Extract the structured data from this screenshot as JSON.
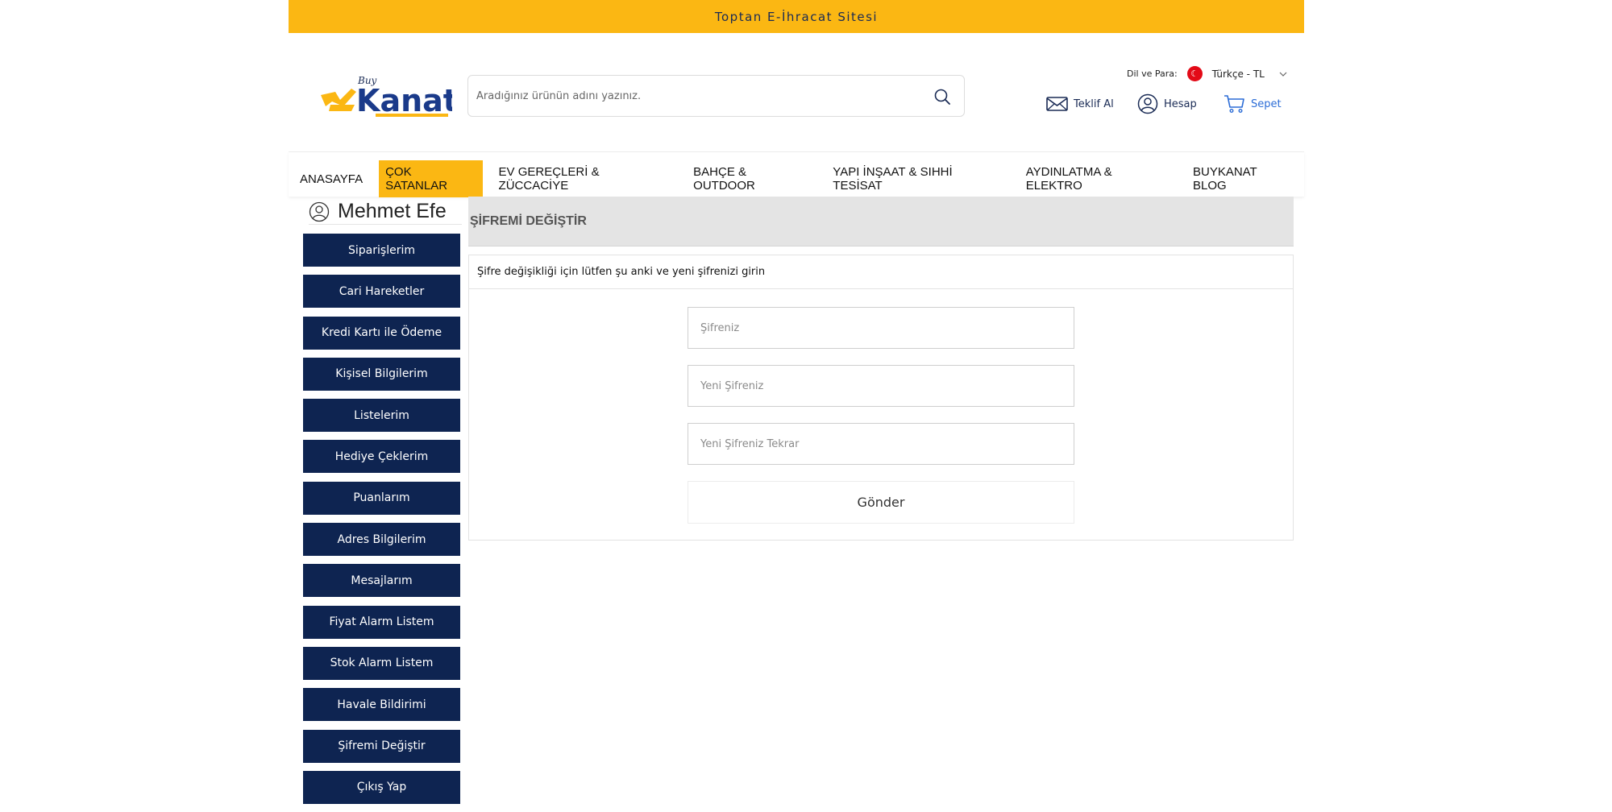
{
  "topbar": {
    "text": "Toptan E-İhracat Sitesi"
  },
  "header": {
    "logo": {
      "text": "Kanat",
      "tag": "Buy"
    },
    "search": {
      "placeholder": "Aradığınız ürünün adını yazınız."
    },
    "language": {
      "label": "Dil ve Para:",
      "value": "Türkçe - TL",
      "flag_glyph": "☾"
    },
    "actions": {
      "quote": "Teklif Al",
      "account": "Hesap",
      "cart": "Sepet"
    }
  },
  "nav": {
    "items": [
      "ANASAYFA",
      "ÇOK SATANLAR",
      "EV GEREÇLERİ & ZÜCCACİYE",
      "BAHÇE & OUTDOOR",
      "YAPI İNŞAAT & SIHHİ TESİSAT",
      "AYDINLATMA & ELEKTRO",
      "BUYKANAT BLOG"
    ],
    "active_index": 1
  },
  "sidebar": {
    "user_name": "Mehmet Efe",
    "menu": [
      "Siparişlerim",
      "Cari Hareketler",
      "Kredi Kartı ile Ödeme",
      "Kişisel Bilgilerim",
      "Listelerim",
      "Hediye Çeklerim",
      "Puanlarım",
      "Adres Bilgilerim",
      "Mesajlarım",
      "Fiyat Alarm Listem",
      "Stok Alarm Listem",
      "Havale Bildirimi",
      "Şifremi Değiştir",
      "Çıkış Yap"
    ]
  },
  "content": {
    "title": "ŞİFREMİ DEĞİŞTİR",
    "info": "Şifre değişikliği için lütfen şu anki ve yeni şifrenizi girin",
    "fields": {
      "current": "Şifreniz",
      "new": "Yeni Şifreniz",
      "repeat": "Yeni Şifreniz Tekrar"
    },
    "submit": "Gönder"
  },
  "colors": {
    "accent": "#fbb713",
    "navy": "#0e2451",
    "cart_blue": "#2b6cd6"
  }
}
